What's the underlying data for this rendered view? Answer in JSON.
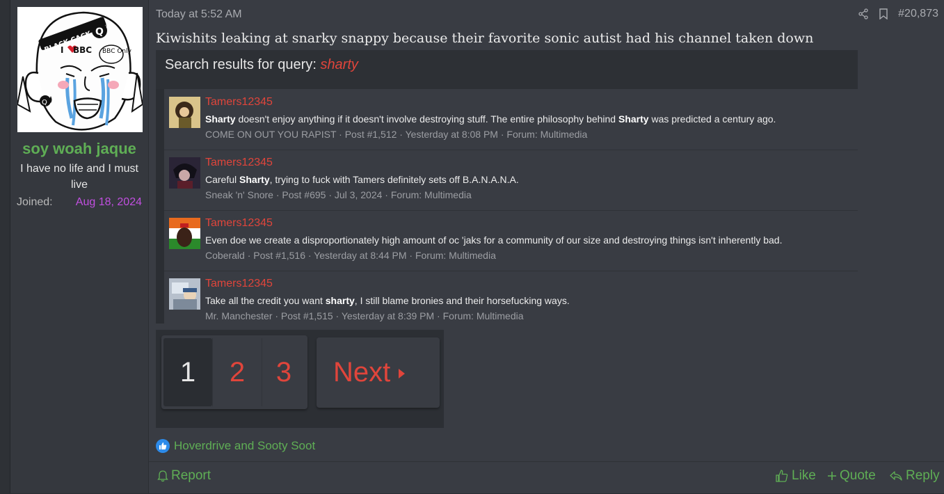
{
  "user": {
    "name": "soy woah jaque",
    "title": "I have no life and I must live",
    "joined_label": "Joined:",
    "joined_value": "Aug 18, 2024",
    "avatar_text": [
      "BLACK CACK SLUT",
      "I",
      "BBC",
      "BBC Only"
    ]
  },
  "post": {
    "date": "Today at 5:52 AM",
    "number": "#20,873",
    "heading": "Kiwishits leaking at snarky snappy because their favorite sonic autist had his channel taken down"
  },
  "embed": {
    "title_prefix": "Search results for query:",
    "query": "sharty",
    "results": [
      {
        "name": "Tamers12345",
        "snippet": [
          {
            "t": "Sharty",
            "b": true
          },
          {
            "t": " doesn't enjoy anything if it doesn't involve destroying stuff. The entire philosophy behind ",
            "b": false
          },
          {
            "t": "Sharty",
            "b": true
          },
          {
            "t": " was predicted a century ago.",
            "b": false
          }
        ],
        "meta": "COME ON OUT YOU RAPIST · Post #1,512 · Yesterday at 8:08 PM · Forum: Multimedia"
      },
      {
        "name": "Tamers12345",
        "snippet": [
          {
            "t": "Careful ",
            "b": false
          },
          {
            "t": "Sharty",
            "b": true
          },
          {
            "t": ", trying to fuck with Tamers definitely sets off B.A.N.A.N.A.",
            "b": false
          }
        ],
        "meta": "Sneak 'n' Snore · Post #695 · Jul 3, 2024 · Forum: Multimedia"
      },
      {
        "name": "Tamers12345",
        "snippet": [
          {
            "t": "Even doe we create a disproportionately high amount of oc 'jaks for a community of our size and destroying things isn't inherently bad.",
            "b": false
          }
        ],
        "meta": "Coberald · Post #1,516 · Yesterday at 8:44 PM · Forum: Multimedia"
      },
      {
        "name": "Tamers12345",
        "snippet": [
          {
            "t": "Take all the credit you want ",
            "b": false
          },
          {
            "t": "sharty",
            "b": true
          },
          {
            "t": ", I still blame bronies and their horsefucking ways.",
            "b": false
          }
        ],
        "meta": "Mr. Manchester · Post #1,515 · Yesterday at 8:39 PM · Forum: Multimedia"
      }
    ]
  },
  "pagination": {
    "pages": [
      "1",
      "2",
      "3"
    ],
    "current": "1",
    "next_label": "Next"
  },
  "reactions": {
    "text": "Hoverdrive and Sooty Soot",
    "icon": "thumbs-up-icon"
  },
  "actions": {
    "report": "Report",
    "like": "Like",
    "quote": "Quote",
    "reply": "Reply"
  },
  "colors": {
    "accent_green": "#5fae55",
    "accent_red": "#e0453b",
    "joined_date": "#c14fe0"
  }
}
